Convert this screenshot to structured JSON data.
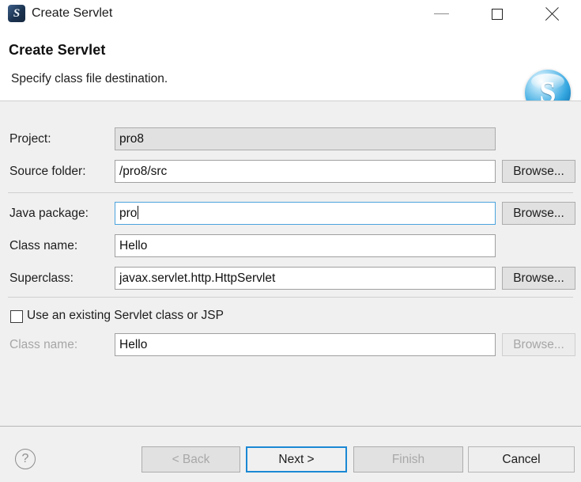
{
  "window": {
    "title": "Create Servlet",
    "app_icon": "servlet-app-icon",
    "controls": {
      "minimize": "minimize-icon",
      "maximize": "maximize-icon",
      "close": "close-icon"
    }
  },
  "banner": {
    "title": "Create Servlet",
    "description": "Specify class file destination.",
    "logo_letter": "S"
  },
  "form": {
    "project": {
      "label": "Project:",
      "value": "pro8"
    },
    "source_folder": {
      "label": "Source folder:",
      "value": "/pro8/src",
      "browse_label": "Browse..."
    },
    "java_package": {
      "label": "Java package:",
      "value": "pro",
      "browse_label": "Browse..."
    },
    "class_name": {
      "label": "Class name:",
      "value": "Hello"
    },
    "superclass": {
      "label": "Superclass:",
      "value": "javax.servlet.http.HttpServlet",
      "browse_label": "Browse..."
    },
    "use_existing": {
      "label": "Use an existing Servlet class or JSP",
      "checked": false
    },
    "existing_class_name": {
      "label": "Class name:",
      "value": "Hello",
      "browse_label": "Browse..."
    }
  },
  "footer": {
    "help_icon": "help-icon",
    "help_glyph": "?",
    "back_label": "< Back",
    "next_label": "Next >",
    "finish_label": "Finish",
    "cancel_label": "Cancel"
  },
  "colors": {
    "focus_blue": "#1b88d4",
    "field_border": "#a0a0a0",
    "dialog_bg": "#f0f0f0",
    "banner_bg": "#ffffff",
    "disabled_text": "#a6a6a6"
  }
}
